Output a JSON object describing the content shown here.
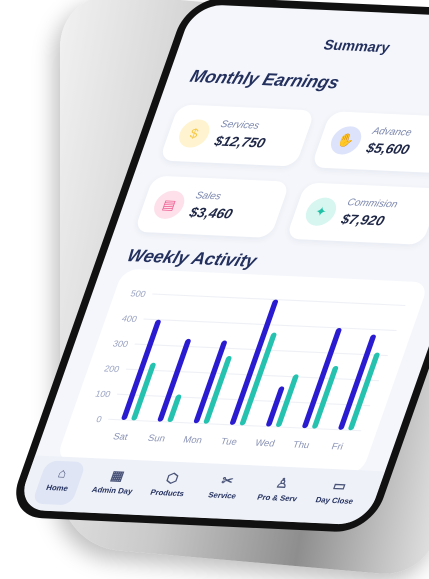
{
  "app": {
    "title": "Summary"
  },
  "sections": {
    "earnings_title": "Monthly Earnings",
    "activity_title": "Weekly Activity"
  },
  "cards": [
    {
      "label": "Services",
      "value": "$12,750",
      "icon": "money-bag-icon",
      "color": "#f6c94a",
      "bg": "#fff4cf"
    },
    {
      "label": "Advance",
      "value": "$5,600",
      "icon": "hand-coin-icon",
      "color": "#3b55c7",
      "bg": "#dde3fb"
    },
    {
      "label": "Sales",
      "value": "$3,460",
      "icon": "receipt-icon",
      "color": "#ef5a8f",
      "bg": "#fde0ea"
    },
    {
      "label": "Commision",
      "value": "$7,920",
      "icon": "piggy-icon",
      "color": "#1fc0a6",
      "bg": "#d6f6ef"
    }
  ],
  "chart_data": {
    "type": "bar",
    "categories": [
      "Sat",
      "Sun",
      "Mon",
      "Tue",
      "Wed",
      "Thu",
      "Fri"
    ],
    "series": [
      {
        "values": [
          400,
          330,
          330,
          500,
          160,
          400,
          380
        ],
        "color": "#2a1bd0"
      },
      {
        "values": [
          230,
          110,
          270,
          370,
          210,
          250,
          310
        ],
        "color": "#25c2b0"
      }
    ],
    "ylim": [
      0,
      500
    ],
    "yticks": [
      "0",
      "100",
      "200",
      "300",
      "400",
      "500"
    ]
  },
  "tabs": [
    {
      "label": "Home",
      "icon": "home-icon"
    },
    {
      "label": "Admin Day",
      "icon": "calendar-icon"
    },
    {
      "label": "Products",
      "icon": "box-icon"
    },
    {
      "label": "Service",
      "icon": "scissors-icon"
    },
    {
      "label": "Pro & Serv",
      "icon": "bag-icon"
    },
    {
      "label": "Day Close",
      "icon": "archive-icon"
    }
  ]
}
